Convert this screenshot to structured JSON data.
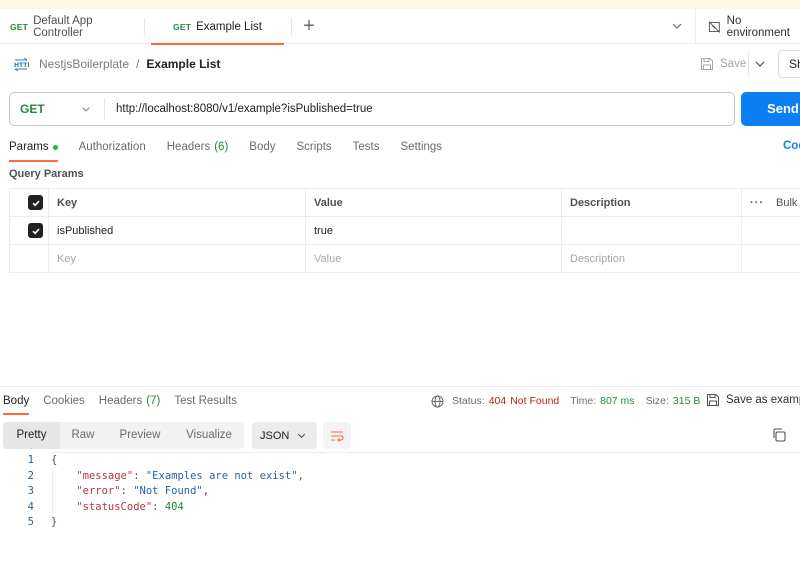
{
  "tabs": [
    {
      "method": "GET",
      "label": "Default App Controller",
      "active": false
    },
    {
      "method": "GET",
      "label": "Example List",
      "active": true
    }
  ],
  "new_tab_label": "+",
  "environment": {
    "label": "No environment",
    "icon": "no-environment-icon"
  },
  "breadcrumb": {
    "icon": "http-icon",
    "collection": "NestjsBoilerplate",
    "separator": "/",
    "request": "Example List"
  },
  "actions": {
    "save_label": "Save",
    "share_label": "Sh"
  },
  "request": {
    "method": "GET",
    "url": "http://localhost:8080/v1/example?isPublished=true",
    "send_label": "Send",
    "tabs": [
      {
        "label": "Params",
        "active": true,
        "dot": true
      },
      {
        "label": "Authorization"
      },
      {
        "label": "Headers",
        "count": "(6)"
      },
      {
        "label": "Body"
      },
      {
        "label": "Scripts"
      },
      {
        "label": "Tests"
      },
      {
        "label": "Settings"
      }
    ],
    "cookies_label": "Coo"
  },
  "query_params": {
    "title": "Query Params",
    "headers": {
      "key": "Key",
      "value": "Value",
      "description": "Description",
      "bulk": "Bulk E"
    },
    "rows": [
      {
        "checked": true,
        "key": "isPublished",
        "value": "true",
        "description": ""
      }
    ],
    "placeholders": {
      "key": "Key",
      "value": "Value",
      "description": "Description"
    }
  },
  "response": {
    "tabs": [
      {
        "label": "Body",
        "active": true
      },
      {
        "label": "Cookies"
      },
      {
        "label": "Headers",
        "count": "(7)"
      },
      {
        "label": "Test Results"
      }
    ],
    "status_label": "Status:",
    "status_code": "404",
    "status_text": "Not Found",
    "time_label": "Time:",
    "time_value": "807 ms",
    "size_label": "Size:",
    "size_value": "315 B",
    "save_example_label": "Save as exampl",
    "formats": [
      "Pretty",
      "Raw",
      "Preview",
      "Visualize"
    ],
    "language": "JSON",
    "body_lines": [
      {
        "n": "1",
        "tokens": [
          {
            "t": "p",
            "v": "{"
          }
        ]
      },
      {
        "n": "2",
        "tokens": [
          {
            "t": "p",
            "v": "    "
          },
          {
            "t": "k",
            "v": "\"message\""
          },
          {
            "t": "p",
            "v": ": "
          },
          {
            "t": "s",
            "v": "\"Examples are not exist\""
          },
          {
            "t": "p",
            "v": ","
          }
        ]
      },
      {
        "n": "3",
        "tokens": [
          {
            "t": "p",
            "v": "    "
          },
          {
            "t": "k",
            "v": "\"error\""
          },
          {
            "t": "p",
            "v": ": "
          },
          {
            "t": "s",
            "v": "\"Not Found\""
          },
          {
            "t": "p",
            "v": ","
          }
        ]
      },
      {
        "n": "4",
        "tokens": [
          {
            "t": "p",
            "v": "    "
          },
          {
            "t": "k",
            "v": "\"statusCode\""
          },
          {
            "t": "p",
            "v": ": "
          },
          {
            "t": "n",
            "v": "404"
          }
        ]
      },
      {
        "n": "5",
        "tokens": [
          {
            "t": "p",
            "v": "}"
          }
        ]
      }
    ]
  },
  "colors": {
    "accent": "#ff6c37",
    "send": "#0c7ff2",
    "method_get": "#248a3d",
    "status_error": "#b42318",
    "status_ok": "#248a3d"
  }
}
